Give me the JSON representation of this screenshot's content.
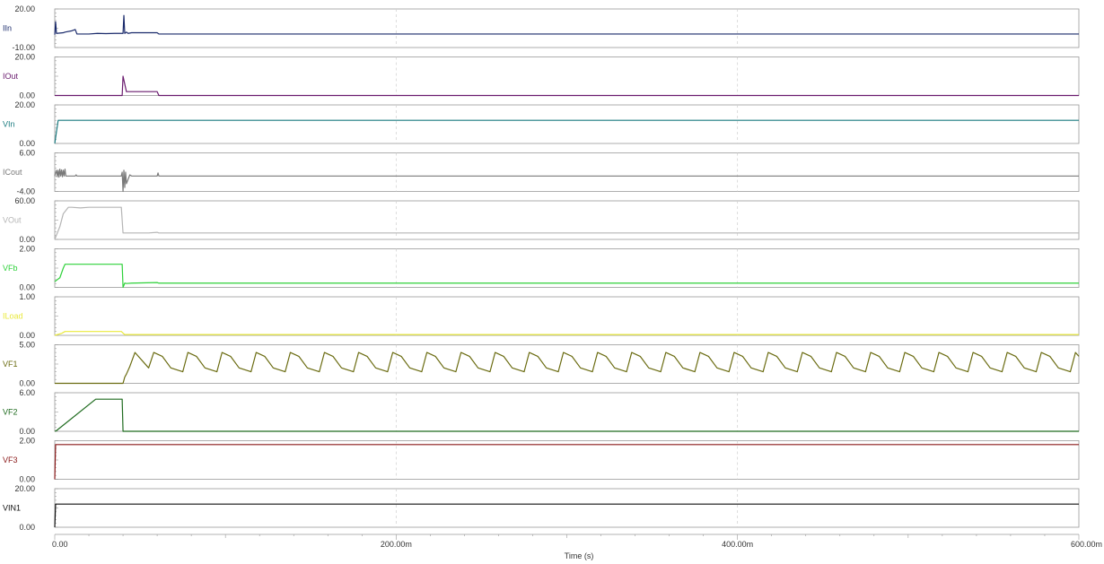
{
  "chart_data": {
    "type": "line",
    "xlabel": "Time (s)",
    "xlim": [
      0,
      600
    ],
    "x_ticks": [
      {
        "value": 0,
        "label": "0.00"
      },
      {
        "value": 200,
        "label": "200.00m"
      },
      {
        "value": 400,
        "label": "400.00m"
      },
      {
        "value": 600,
        "label": "600.00m"
      }
    ],
    "grid": true,
    "panels": [
      {
        "name": "IIn",
        "color": "#1a2a6b",
        "ylim": [
          -10,
          20
        ],
        "ymax_label": "20.00",
        "ymin_label": "-10.00",
        "x": [
          0,
          0.5,
          1,
          5,
          6,
          10,
          12,
          13,
          20,
          25,
          30,
          35,
          40,
          40.5,
          41,
          42,
          43,
          45,
          55,
          60,
          61,
          600
        ],
        "y": [
          0,
          10,
          1,
          1.5,
          2,
          3,
          4,
          0.5,
          0.5,
          1,
          0.8,
          1,
          1,
          15,
          1,
          2,
          1,
          1.5,
          1.5,
          1.5,
          0.5,
          0.5
        ]
      },
      {
        "name": "IOut",
        "color": "#6a1b6e",
        "ylim": [
          0,
          20
        ],
        "ymax_label": "20.00",
        "ymin_label": "0.00",
        "x": [
          0,
          39.5,
          40,
          41,
          42,
          45,
          60,
          61,
          600
        ],
        "y": [
          0,
          0,
          10,
          6,
          2,
          2,
          2,
          0,
          0
        ]
      },
      {
        "name": "VIn",
        "color": "#1b7b80",
        "ylim": [
          0,
          20
        ],
        "ymax_label": "20.00",
        "ymin_label": "0.00",
        "x": [
          0,
          1,
          2,
          600
        ],
        "y": [
          0,
          6,
          12,
          12
        ]
      },
      {
        "name": "ICout",
        "color": "#7a7a7a",
        "ylim": [
          -4,
          6
        ],
        "ymax_label": "6.00",
        "ymin_label": "-4.00",
        "x": [
          0,
          1,
          1.5,
          2,
          2.5,
          3,
          3.5,
          4,
          4.5,
          5,
          5.5,
          6,
          6.5,
          7,
          12,
          12.5,
          13,
          39,
          39.5,
          40,
          40.5,
          41,
          41.5,
          42,
          43,
          44,
          45,
          60,
          60.5,
          61,
          600
        ],
        "y": [
          0,
          1.5,
          -0.2,
          1.5,
          -0.3,
          1.8,
          0,
          1.6,
          -0.2,
          1.5,
          0,
          1.8,
          0,
          0,
          0,
          0.3,
          0,
          0,
          1,
          -4,
          1.5,
          -3,
          1,
          -2,
          -0.8,
          0.3,
          0,
          0,
          0.8,
          0,
          0
        ]
      },
      {
        "name": "VOut",
        "color": "#b5b5b5",
        "ylim": [
          0,
          60
        ],
        "ymax_label": "60.00",
        "ymin_label": "0.00",
        "x": [
          0,
          3,
          5,
          8,
          10,
          15,
          20,
          38,
          39,
          40,
          41,
          55,
          60,
          61,
          600
        ],
        "y": [
          0,
          20,
          40,
          50,
          50,
          49,
          50,
          50,
          50,
          10,
          10,
          10,
          11,
          10,
          10
        ]
      },
      {
        "name": "VFb",
        "color": "#2ed13a",
        "ylim": [
          0,
          2
        ],
        "ymax_label": "2.00",
        "ymin_label": "0.00",
        "x": [
          0,
          3,
          5,
          6,
          39,
          39.5,
          40,
          41,
          42,
          45,
          60,
          61,
          600
        ],
        "y": [
          0.3,
          0.5,
          1,
          1.2,
          1.2,
          1.2,
          0,
          0.22,
          0.2,
          0.22,
          0.25,
          0.22,
          0.22
        ]
      },
      {
        "name": "ILoad",
        "color": "#e9e93b",
        "ylim": [
          0,
          1
        ],
        "ymax_label": "1.00",
        "ymin_label": "0.00",
        "x": [
          0,
          4,
          6,
          39,
          41,
          600
        ],
        "y": [
          0,
          0.05,
          0.1,
          0.1,
          0.02,
          0.02
        ]
      },
      {
        "name": "VF1",
        "color": "#6a6b10",
        "ylim": [
          0,
          5
        ],
        "ymax_label": "5.00",
        "ymin_label": "0.00",
        "x": [
          0,
          40,
          41,
          42,
          44,
          47,
          55,
          58,
          63,
          68,
          75,
          78,
          83,
          88,
          95,
          98,
          103,
          108,
          115,
          118,
          123,
          128,
          135,
          138,
          143,
          148,
          155,
          158,
          163,
          168,
          175,
          178,
          183,
          188,
          195,
          198,
          203,
          208,
          215,
          218,
          223,
          228,
          235,
          238,
          243,
          248,
          255,
          258,
          263,
          268,
          275,
          278,
          283,
          288,
          295,
          298,
          303,
          308,
          315,
          318,
          323,
          328,
          335,
          338,
          343,
          348,
          355,
          358,
          363,
          368,
          375,
          378,
          383,
          388,
          395,
          398,
          403,
          408,
          415,
          418,
          423,
          428,
          435,
          438,
          443,
          448,
          455,
          458,
          463,
          468,
          475,
          478,
          483,
          488,
          495,
          498,
          503,
          508,
          515,
          518,
          523,
          528,
          535,
          538,
          543,
          548,
          555,
          558,
          563,
          568,
          575,
          578,
          583,
          588,
          595,
          598,
          600
        ],
        "y": [
          0,
          0,
          0.8,
          1.2,
          2.2,
          4,
          2,
          4,
          3.5,
          2,
          1.5,
          4,
          3.5,
          2,
          1.5,
          4,
          3.5,
          2,
          1.5,
          4,
          3.5,
          2,
          1.5,
          4,
          3.5,
          2,
          1.5,
          4,
          3.5,
          2,
          1.5,
          4,
          3.5,
          2,
          1.5,
          4,
          3.5,
          2,
          1.5,
          4,
          3.5,
          2,
          1.5,
          4,
          3.5,
          2,
          1.5,
          4,
          3.5,
          2,
          1.5,
          4,
          3.5,
          2,
          1.5,
          4,
          3.5,
          2,
          1.5,
          4,
          3.5,
          2,
          1.5,
          4,
          3.5,
          2,
          1.5,
          4,
          3.5,
          2,
          1.5,
          4,
          3.5,
          2,
          1.5,
          4,
          3.5,
          2,
          1.5,
          4,
          3.5,
          2,
          1.5,
          4,
          3.5,
          2,
          1.5,
          4,
          3.5,
          2,
          1.5,
          4,
          3.5,
          2,
          1.5,
          4,
          3.5,
          2,
          1.5,
          4,
          3.5,
          2,
          1.5,
          4,
          3.5,
          2,
          1.5,
          4,
          3.5,
          2,
          1.5,
          4,
          3.5,
          2,
          1.5,
          4,
          3.5,
          2.5
        ]
      },
      {
        "name": "VF2",
        "color": "#1f6b1f",
        "ylim": [
          0,
          6
        ],
        "ymax_label": "6.00",
        "ymin_label": "0.00",
        "x": [
          0,
          1,
          24,
          25,
          39.5,
          40,
          600
        ],
        "y": [
          0,
          0.1,
          5,
          5,
          5,
          0,
          0
        ]
      },
      {
        "name": "VF3",
        "color": "#8b1a1a",
        "ylim": [
          0,
          2
        ],
        "ymax_label": "2.00",
        "ymin_label": "0.00",
        "x": [
          0,
          0.5,
          1,
          600
        ],
        "y": [
          0,
          1.8,
          1.8,
          1.8
        ]
      },
      {
        "name": "VIN1",
        "color": "#111111",
        "ylim": [
          0,
          20
        ],
        "ymax_label": "20.00",
        "ymin_label": "0.00",
        "x": [
          0,
          0.5,
          1,
          600
        ],
        "y": [
          0,
          12,
          12,
          12
        ]
      }
    ]
  }
}
